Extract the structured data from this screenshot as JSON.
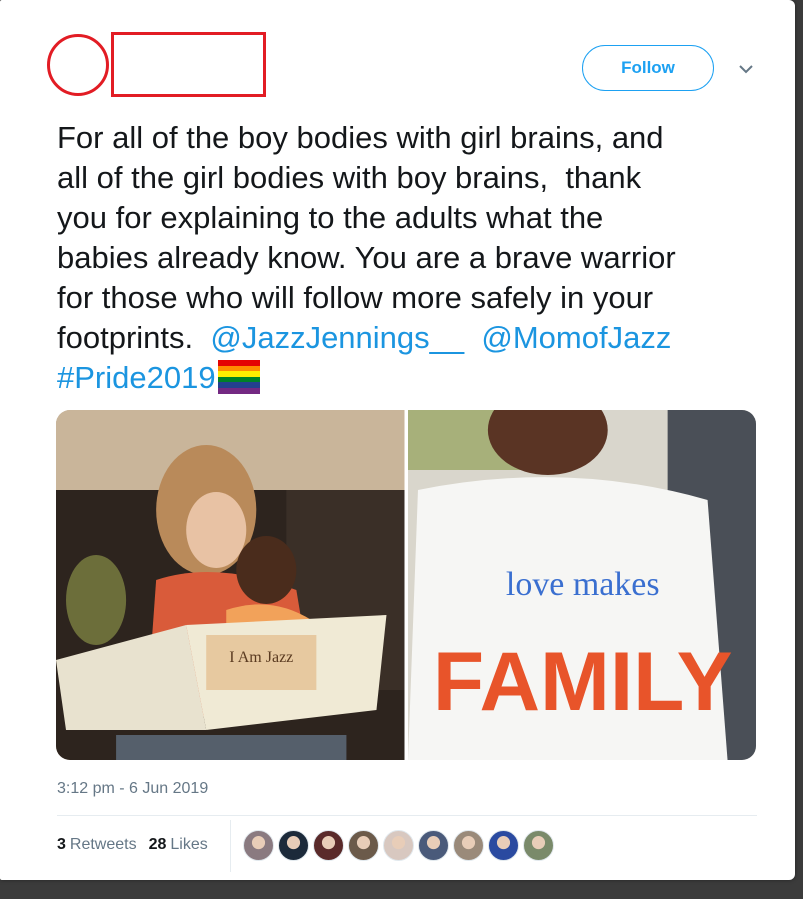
{
  "tweet": {
    "lines": [
      "For all of the boy bodies with girl brains, and",
      "all of the girl bodies with boy brains,  thank",
      "you for explaining to the adults what the",
      "babies already know. You are a brave warrior",
      "for those who will follow more safely in your"
    ],
    "last_line_prefix": "footprints.  ",
    "mention1": "@JazzJennings__",
    "mention_gap": "  ",
    "mention2": "@MomofJazz",
    "hashtag": "#Pride2019",
    "emoji": "rainbow-flag-icon"
  },
  "follow_label": "Follow",
  "images": [
    {
      "alt_icon": "photo-woman-reading-book"
    },
    {
      "alt_icon": "photo-love-makes-family-shirt"
    }
  ],
  "book_text": "I Am Jazz",
  "shirt_text": {
    "line1": "love makes",
    "line2": "FAMILY"
  },
  "timestamp": "3:12 pm - 6 Jun 2019",
  "stats": {
    "retweets_count": "3",
    "retweets_label": "Retweets",
    "likes_count": "28",
    "likes_label": "Likes"
  },
  "colors": {
    "link": "#1b95e0",
    "follow": "#1da1f2",
    "redaction": "#e21c24"
  },
  "avatar_colors": [
    "#8a7a80",
    "#1c2a3a",
    "#5a2a2a",
    "#6b5a4a",
    "#d8c8c0",
    "#4a5a7a",
    "#9a8a7a",
    "#2a4aa0",
    "#7a8a6a"
  ]
}
